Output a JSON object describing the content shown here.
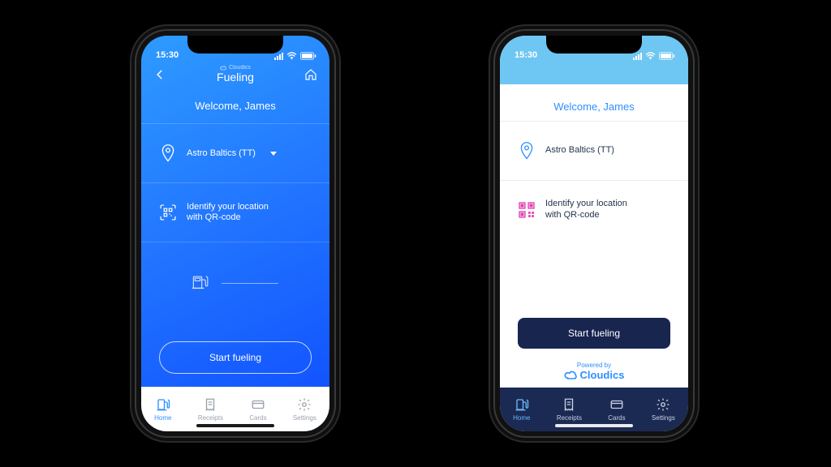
{
  "status": {
    "time": "15:30"
  },
  "brand": {
    "name": "Cloudics",
    "powered_by": "Powered by"
  },
  "phone1": {
    "nav_title": "Fueling",
    "welcome": "Welcome, James",
    "station": "Astro Baltics (TT)",
    "qr_line1": "Identify your location",
    "qr_line2": "with QR-code",
    "cta": "Start fueling"
  },
  "phone2": {
    "welcome": "Welcome, James",
    "station": "Astro Baltics (TT)",
    "qr_line1": "Identify your location",
    "qr_line2": "with QR-code",
    "cta": "Start fueling"
  },
  "tabs": {
    "home": "Home",
    "receipts": "Receipts",
    "cards": "Cards",
    "settings": "Settings"
  }
}
